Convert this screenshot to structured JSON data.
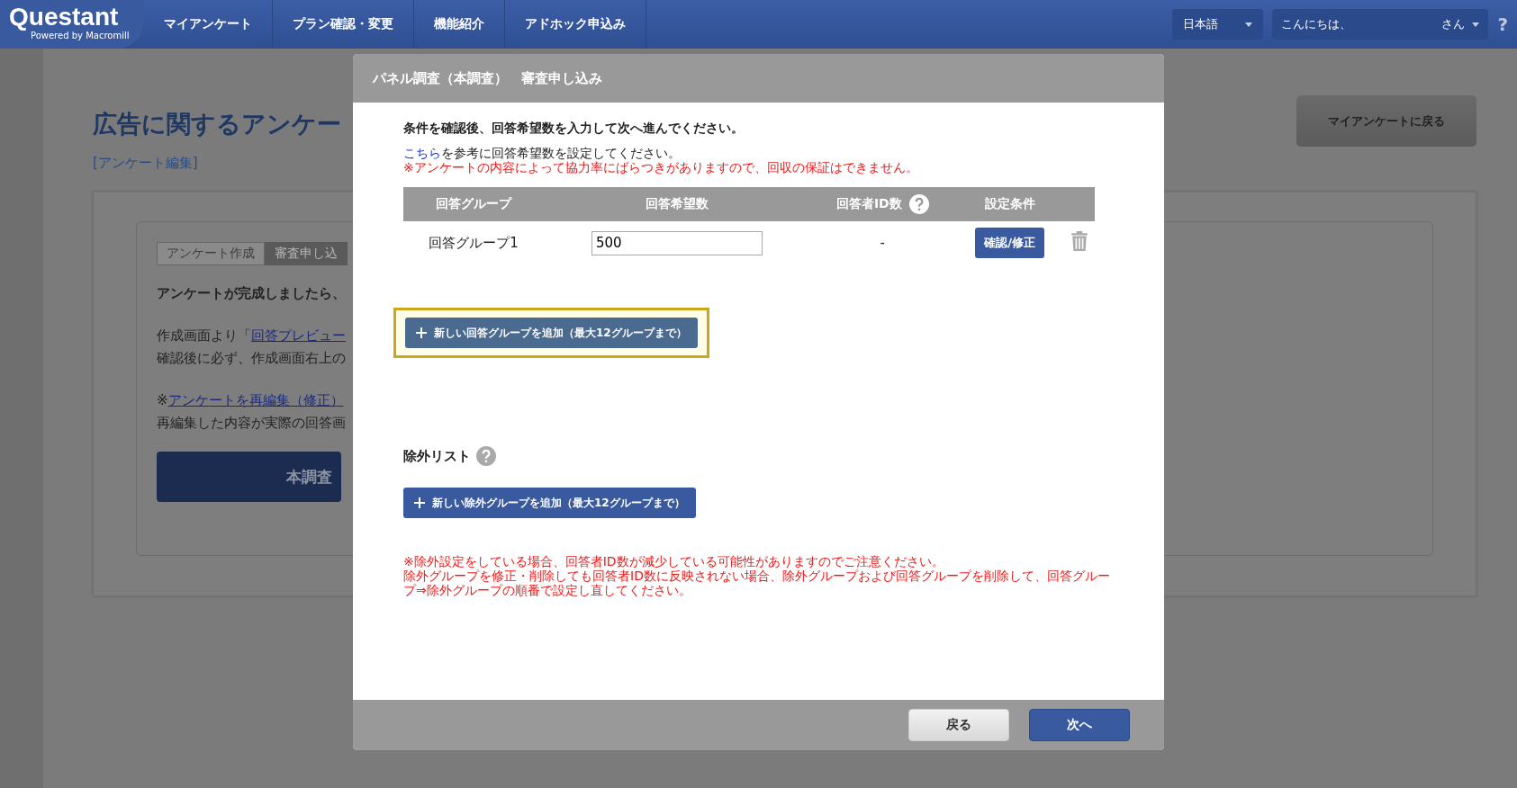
{
  "header": {
    "logo": "Questant",
    "tagline": "Powered by Macromill",
    "nav": [
      "マイアンケート",
      "プラン確認・変更",
      "機能紹介",
      "アドホック申込み"
    ],
    "language": "日本語",
    "greeting_prefix": "こんにちは、",
    "greeting_suffix": "さん",
    "help": "?"
  },
  "page": {
    "title": "広告に関するアンケー",
    "edit_link": "[アンケート編集]",
    "back_button": "マイアンケートに戻る",
    "steps": [
      {
        "label": "アンケート作成",
        "selected": false
      },
      {
        "label": "審査申し込",
        "selected": true
      }
    ],
    "intro": "アンケートが完成しましたら、",
    "preview_prefix": "作成画面より「",
    "preview_link": "回答プレビュー",
    "confirm_line": "確認後に必ず、作成画面右上の",
    "reedit_prefix": "※",
    "reedit_link": "アンケートを再編集（修正）",
    "reedit_line": "再編集した内容が実際の回答画",
    "main_button": "本調査"
  },
  "modal": {
    "title": "パネル調査（本調査）　審査申し込み",
    "instruction": "条件を確認後、回答希望数を入力して次へ進んでください。",
    "hint_link": "こちら",
    "hint_text": "を参考に回答希望数を設定してください。",
    "warning": "※アンケートの内容によって協力率にばらつきがありますので、回収の保証はできません。",
    "table": {
      "columns": [
        {
          "label": "回答グループ",
          "help": false
        },
        {
          "label": "回答希望数",
          "help": false
        },
        {
          "label": "回答者ID数",
          "help": true
        },
        {
          "label": "設定条件",
          "help": false
        }
      ],
      "rows": [
        {
          "group": "回答グループ1",
          "desired": "500",
          "id_count": "-",
          "action": "確認/修正"
        }
      ]
    },
    "add_group_button": {
      "label": "新しい回答グループを追加（最大12グループまで）",
      "highlighted": true
    },
    "exclusion_title": "除外リスト",
    "add_exclusion_button": {
      "label": "新しい除外グループを追加（最大12グループまで）",
      "highlighted": false
    },
    "notes": [
      "※除外設定をしている場合、回答者ID数が減少している可能性がありますのでご注意ください。",
      "除外グループを修正・削除しても回答者ID数に反映されない場合、除外グループおよび回答グループを削除して、回答グループ⇒除外グループの順番で設定し直してください。"
    ],
    "buttons": [
      {
        "label": "戻る",
        "kind": "secondary"
      },
      {
        "label": "次へ",
        "kind": "primary"
      }
    ]
  }
}
